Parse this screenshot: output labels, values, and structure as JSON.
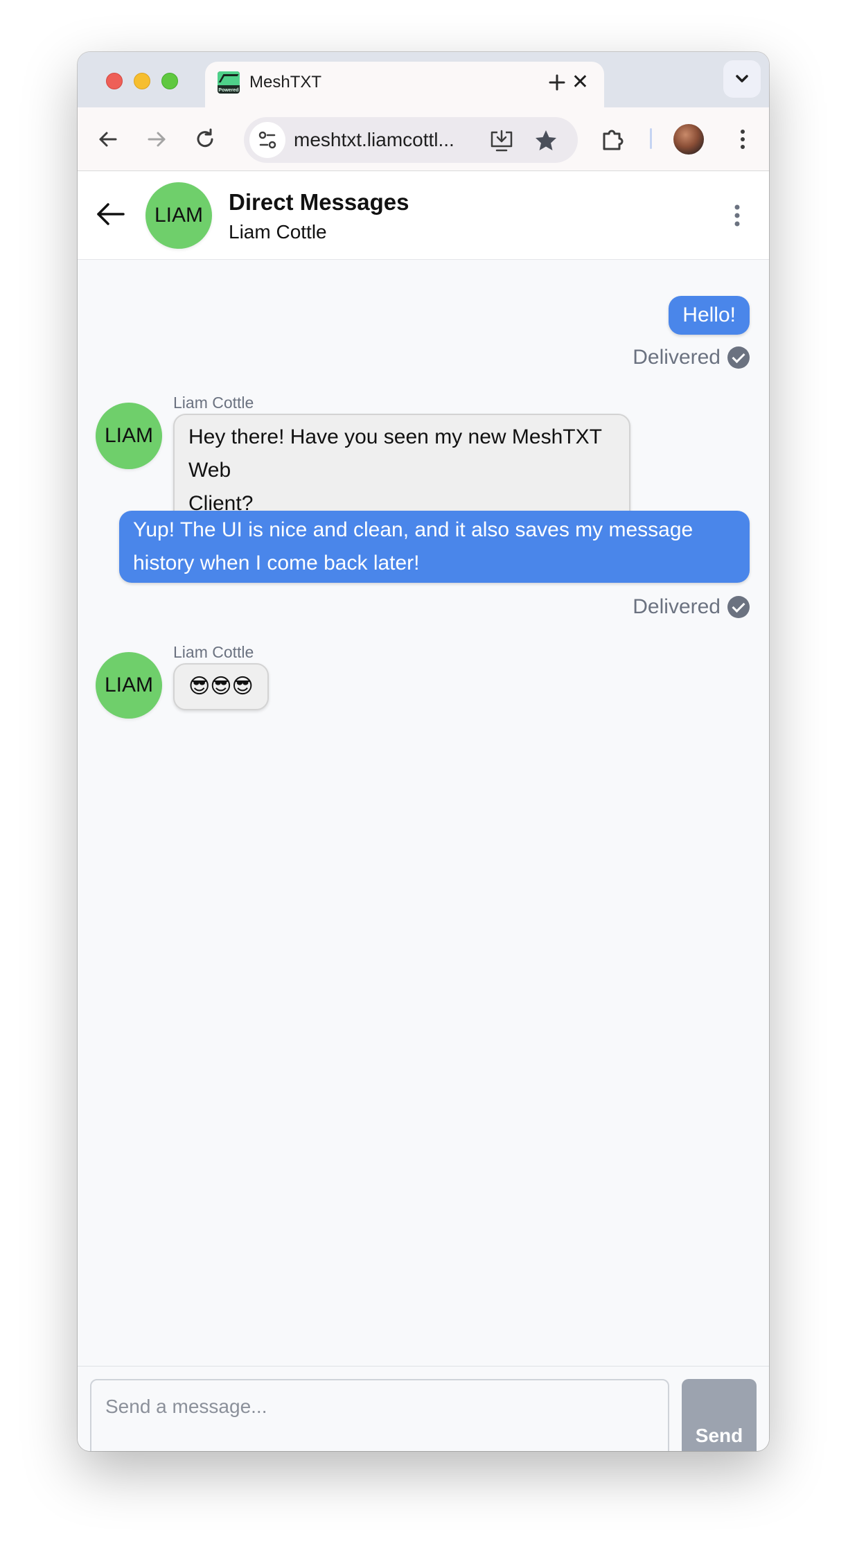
{
  "browser": {
    "tab_title": "MeshTXT",
    "favicon_text": "Powered",
    "url": "meshtxt.liamcottl...",
    "new_tab_symbol": "+"
  },
  "header": {
    "avatar_text": "LIAM",
    "title": "Direct Messages",
    "subtitle": "Liam Cottle"
  },
  "messages": [
    {
      "direction": "outgoing",
      "text": "Hello!",
      "status": "Delivered"
    },
    {
      "direction": "incoming",
      "sender": "Liam Cottle",
      "avatar_text": "LIAM",
      "lines": [
        "Hey there! Have you seen my new MeshTXT Web",
        "Client?"
      ]
    },
    {
      "direction": "outgoing",
      "lines": [
        "Yup! The UI is nice and clean, and it also saves my message",
        "history when I come back later!"
      ],
      "status": "Delivered"
    },
    {
      "direction": "incoming",
      "sender": "Liam Cottle",
      "avatar_text": "LIAM",
      "text": "😎😎😎"
    }
  ],
  "composer": {
    "placeholder": "Send a message...",
    "send_label": "Send"
  },
  "colors": {
    "outgoing_bubble": "#4a86ea",
    "avatar": "#6fcf6b",
    "send_button_disabled": "#9ca3af"
  }
}
